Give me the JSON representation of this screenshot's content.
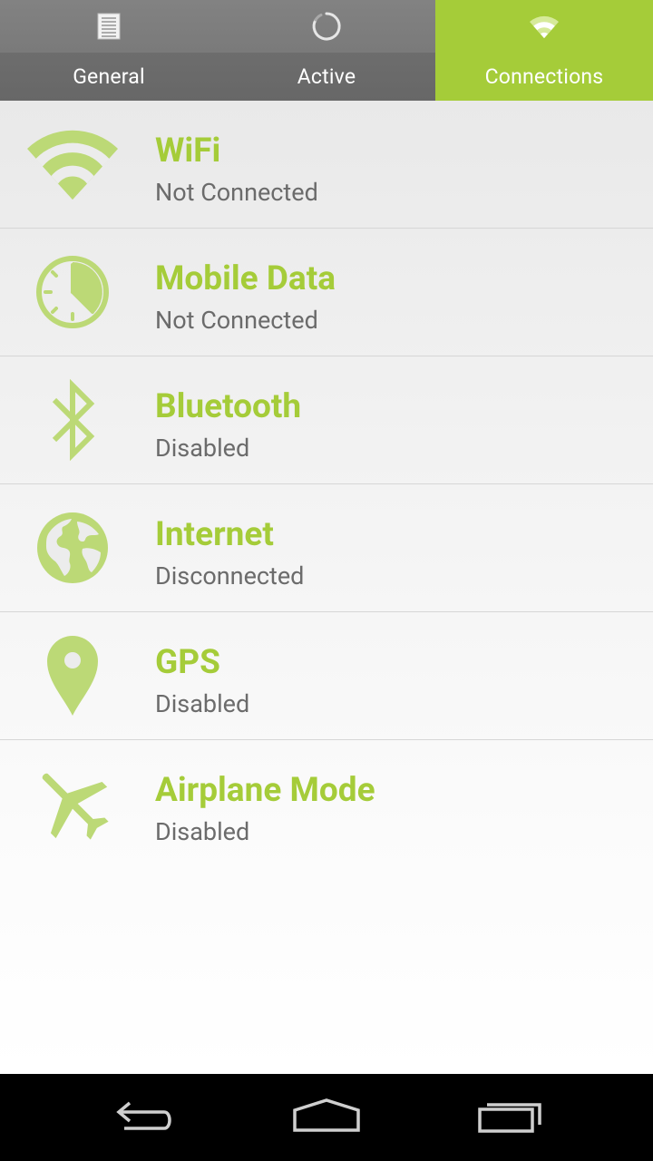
{
  "tabs": [
    {
      "label": "General",
      "icon": "document-icon",
      "selected": false
    },
    {
      "label": "Active",
      "icon": "spinner-icon",
      "selected": false
    },
    {
      "label": "Connections",
      "icon": "wifi-icon",
      "selected": true
    }
  ],
  "connections": [
    {
      "title": "WiFi",
      "status": "Not Connected",
      "icon": "wifi-icon"
    },
    {
      "title": "Mobile Data",
      "status": "Not Connected",
      "icon": "clock-icon"
    },
    {
      "title": "Bluetooth",
      "status": "Disabled",
      "icon": "bluetooth-icon"
    },
    {
      "title": "Internet",
      "status": "Disconnected",
      "icon": "globe-icon"
    },
    {
      "title": "GPS",
      "status": "Disabled",
      "icon": "location-pin-icon"
    },
    {
      "title": "Airplane Mode",
      "status": "Disabled",
      "icon": "airplane-icon"
    }
  ],
  "navbar": {
    "buttons": [
      "back-icon",
      "home-icon",
      "recent-apps-icon"
    ]
  },
  "colors": {
    "accent": "#a5cc39",
    "tab_bg": "#7a7a7a",
    "status_text": "#6b6b6b",
    "navbar_bg": "#000000"
  }
}
